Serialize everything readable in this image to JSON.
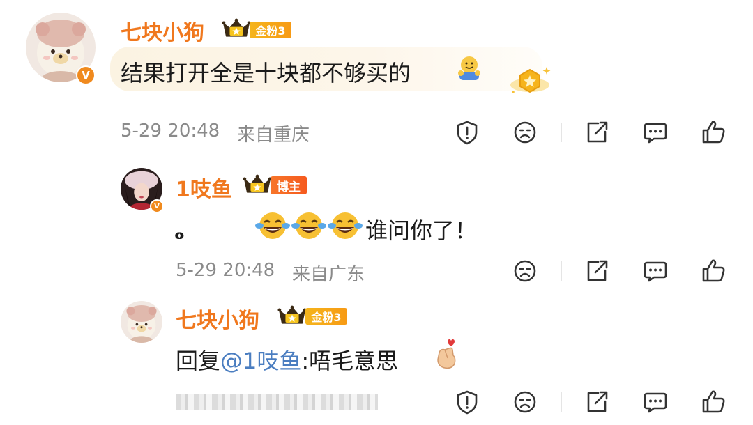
{
  "comments": [
    {
      "username": "七块小狗",
      "fan_badge": "金粉3",
      "content": "结果打开全是十块都不够买的",
      "content_emoji": "hug-emoji",
      "time": "5-29 20:48",
      "location": "来自重庆"
    },
    {
      "username": "1吱鱼",
      "fan_badge": "博主",
      "content_dots": "。。。。",
      "content": "谁问你了！",
      "content_emoji": "tears-of-joy-emoji",
      "time": "5-29 20:48",
      "location": "来自广东"
    },
    {
      "username": "七块小狗",
      "fan_badge": "金粉3",
      "reply_prefix": "回复",
      "mention": "@1吱鱼",
      "content": ":唔毛意思",
      "content_emoji": "finger-heart-emoji"
    }
  ],
  "icons": {
    "report": "report-shield-icon",
    "dislike": "sad-face-icon",
    "share": "share-icon",
    "comment": "comment-icon",
    "like": "thumbs-up-icon"
  },
  "colors": {
    "username": "#f0781e",
    "fan_badge": "#f5a818",
    "blogger_badge": "#f7692a",
    "mention": "#4a7dc0",
    "meta": "#8a8a8a"
  }
}
